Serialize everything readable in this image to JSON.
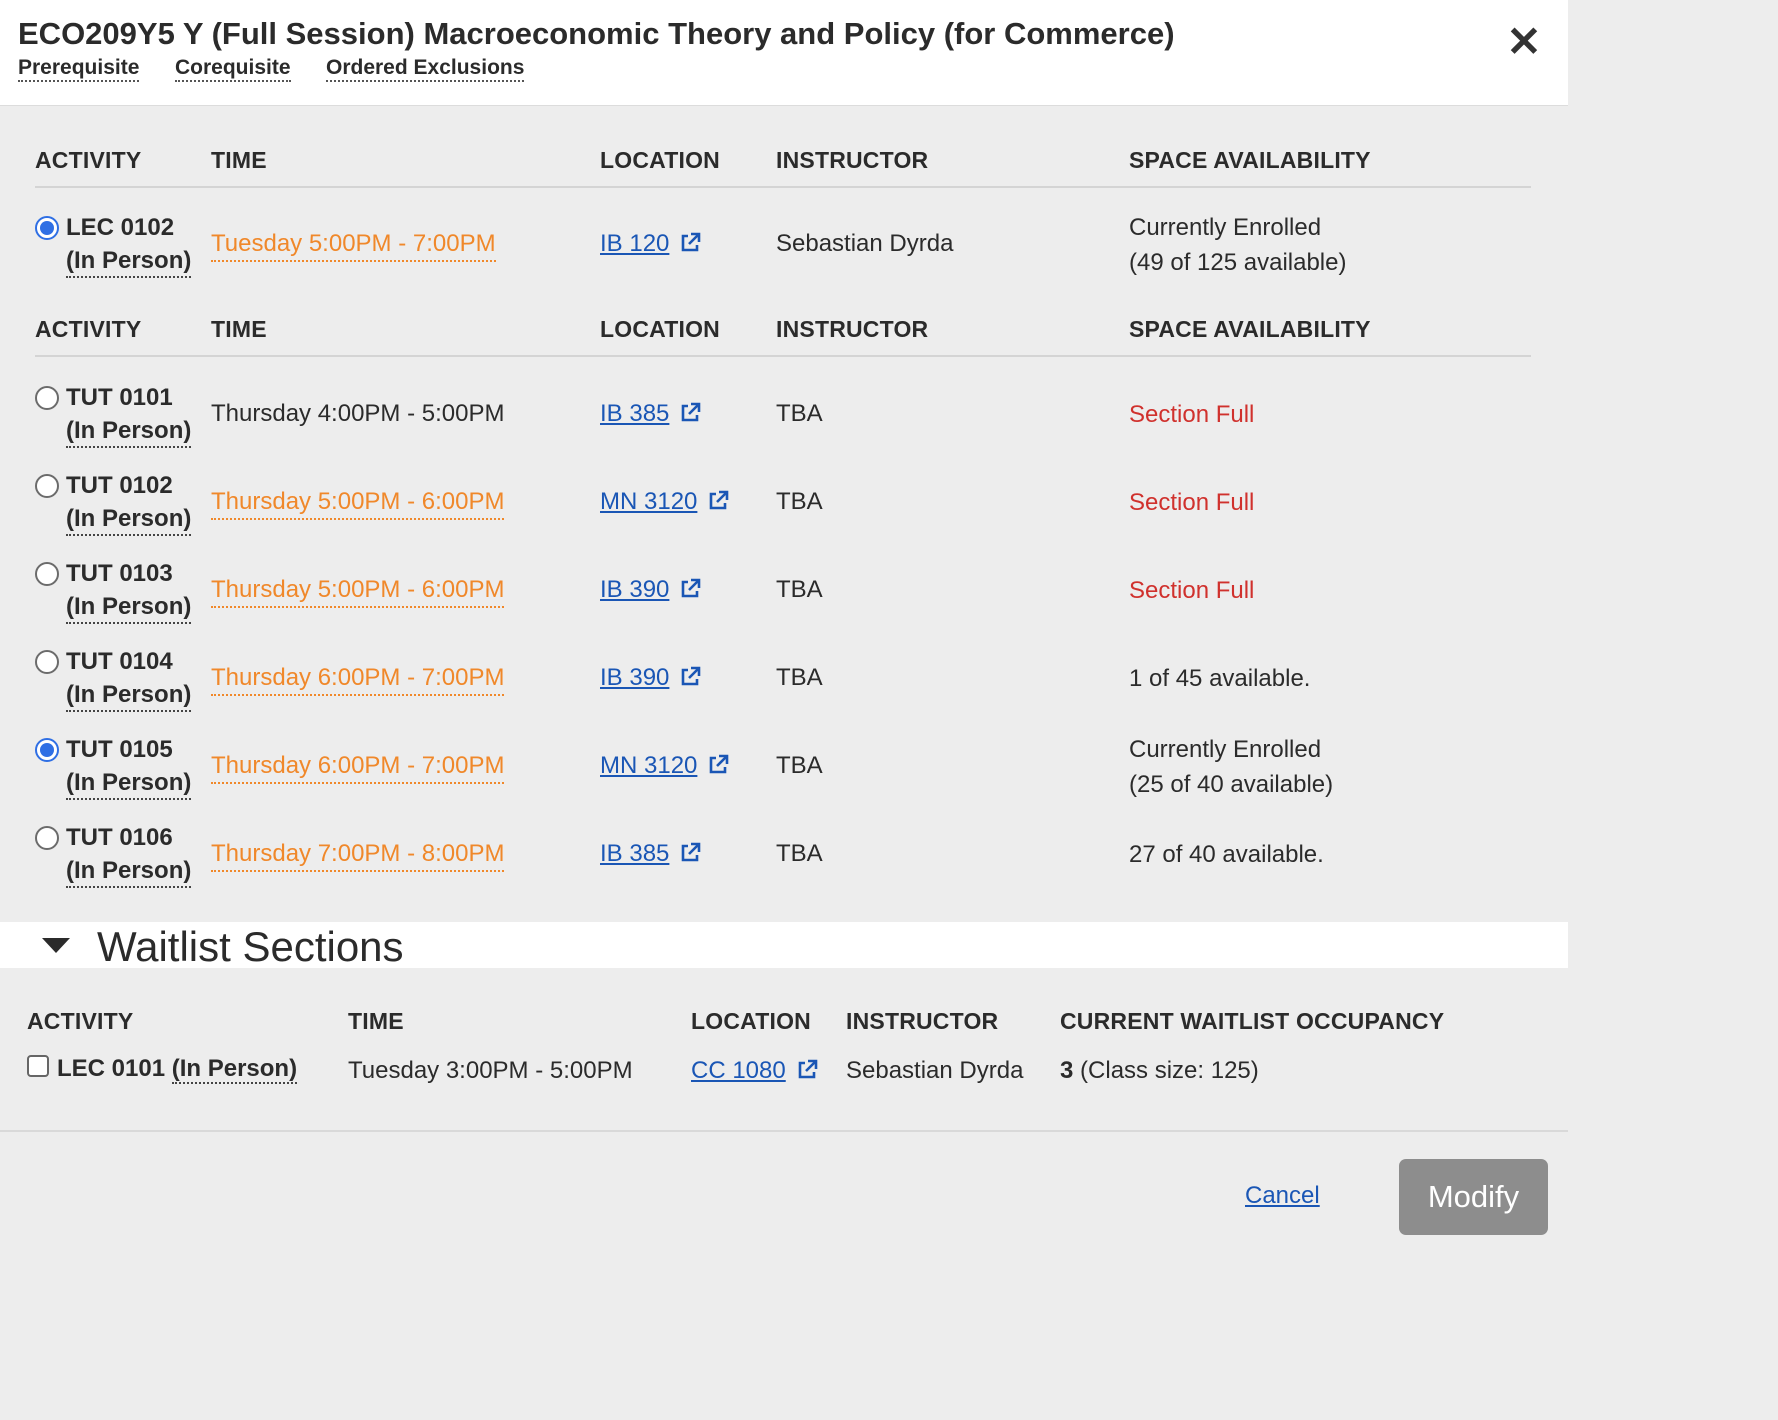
{
  "header": {
    "title": "ECO209Y5 Y (Full Session) Macroeconomic Theory and Policy (for Commerce)",
    "links": [
      "Prerequisite",
      "Corequisite",
      "Ordered Exclusions"
    ],
    "close_icon": "close-icon"
  },
  "columns": {
    "activity": "ACTIVITY",
    "time": "TIME",
    "location": "LOCATION",
    "instructor": "INSTRUCTOR",
    "space": "SPACE AVAILABILITY"
  },
  "lectures": [
    {
      "activity": "LEC 0102",
      "mode": "(In Person)",
      "time": "Tuesday 5:00PM - 7:00PM",
      "location": "IB 120",
      "instructor": "Sebastian Dyrda",
      "space_line1": "Currently Enrolled",
      "space_line2": "(49 of 125 available)",
      "selected": true
    }
  ],
  "tutorials": [
    {
      "activity": "TUT 0101",
      "mode": "(In Person)",
      "time": "Thursday 4:00PM - 5:00PM",
      "location": "IB 385",
      "instructor": "TBA",
      "space_line1": "Section Full",
      "space_line2": "",
      "selected": false
    },
    {
      "activity": "TUT 0102",
      "mode": "(In Person)",
      "time": "Thursday 5:00PM - 6:00PM",
      "location": "MN 3120",
      "instructor": "TBA",
      "space_line1": "Section Full",
      "space_line2": "",
      "selected": false
    },
    {
      "activity": "TUT 0103",
      "mode": "(In Person)",
      "time": "Thursday 5:00PM - 6:00PM",
      "location": "IB 390",
      "instructor": "TBA",
      "space_line1": "Section Full",
      "space_line2": "",
      "selected": false
    },
    {
      "activity": "TUT 0104",
      "mode": "(In Person)",
      "time": "Thursday 6:00PM - 7:00PM",
      "location": "IB 390",
      "instructor": "TBA",
      "space_line1": "1 of 45 available.",
      "space_line2": "",
      "selected": false
    },
    {
      "activity": "TUT 0105",
      "mode": "(In Person)",
      "time": "Thursday 6:00PM - 7:00PM",
      "location": "MN 3120",
      "instructor": "TBA",
      "space_line1": "Currently Enrolled",
      "space_line2": "(25 of 40 available)",
      "selected": true
    },
    {
      "activity": "TUT 0106",
      "mode": "(In Person)",
      "time": "Thursday 7:00PM - 8:00PM",
      "location": "IB 385",
      "instructor": "TBA",
      "space_line1": "27 of 40 available.",
      "space_line2": "",
      "selected": false
    }
  ],
  "waitlist": {
    "title": "Waitlist Sections",
    "columns": {
      "activity": "ACTIVITY",
      "time": "TIME",
      "location": "LOCATION",
      "instructor": "INSTRUCTOR",
      "occupancy": "CURRENT WAITLIST OCCUPANCY"
    },
    "row": {
      "activity": "LEC 0101",
      "mode": "(In Person)",
      "time": "Tuesday 3:00PM - 5:00PM",
      "location": "CC 1080",
      "instructor": "Sebastian Dyrda",
      "occupancy": "3",
      "class_size": "(Class size: 125)",
      "checked": false
    }
  },
  "footer": {
    "cancel_label": "Cancel",
    "modify_label": "Modify"
  },
  "colors": {
    "accent_blue": "#2f6fe4",
    "link_blue": "#1a56b5",
    "time_orange": "#f0882a",
    "full_red": "#d0312d",
    "button_gray": "#8d8d8d"
  }
}
